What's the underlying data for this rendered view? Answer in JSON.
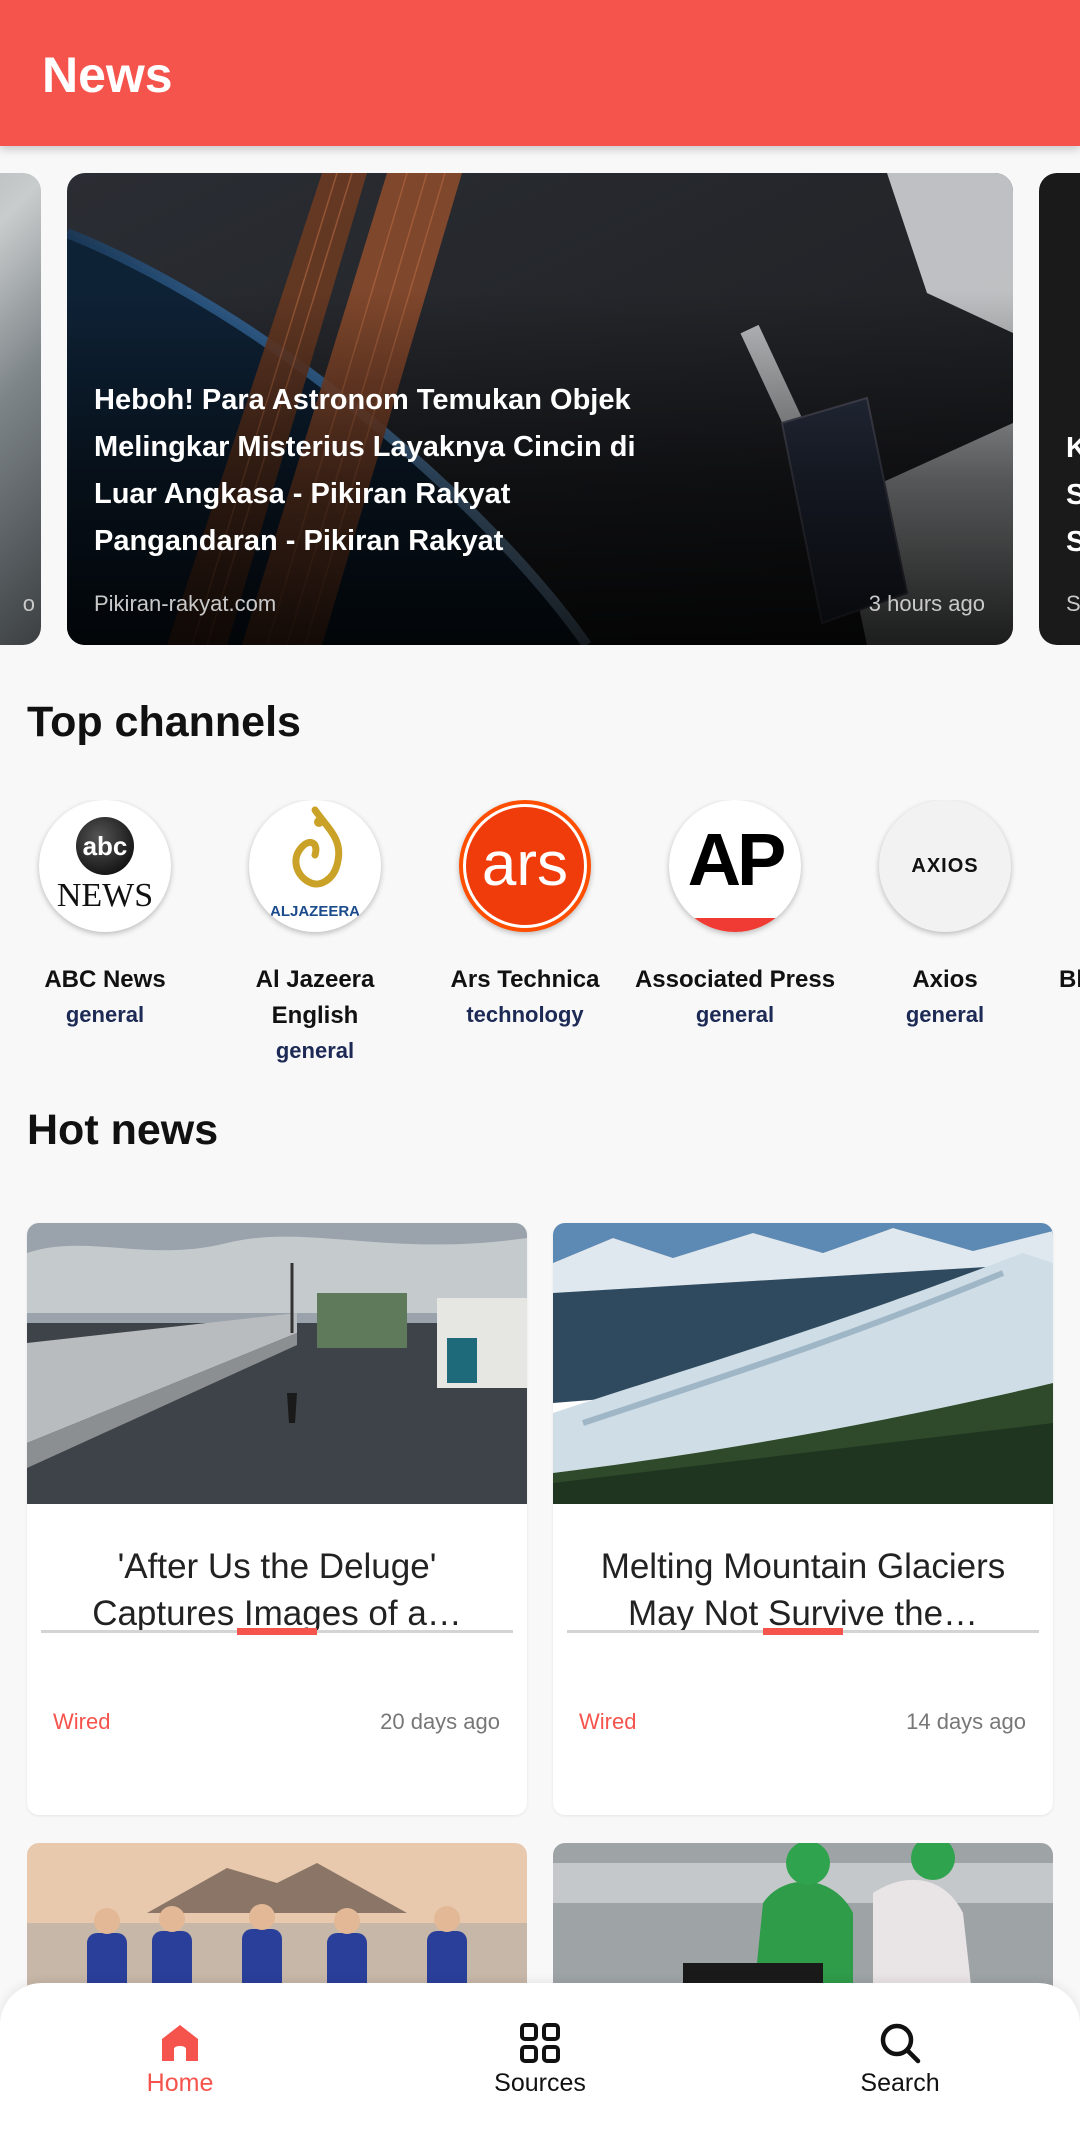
{
  "app": {
    "title": "News"
  },
  "carousel": {
    "prev": {
      "meta": "o"
    },
    "main": {
      "title": "Heboh! Para Astronom Temukan Objek Melingkar Misterius Layaknya Cincin di Luar Angkasa - Pikiran Rakyat Pangandaran - Pikiran Rakyat",
      "source": "Pikiran-rakyat.com",
      "time": "3 hours ago"
    },
    "next": {
      "line1": "K",
      "line2": "S",
      "line3": "S",
      "meta": "S"
    }
  },
  "top_channels": {
    "title": "Top channels",
    "items": [
      {
        "name": "ABC News",
        "category": "general",
        "logo": "abc-news-logo"
      },
      {
        "name": "Al Jazeera English",
        "category": "general",
        "logo": "al-jazeera-logo"
      },
      {
        "name": "Ars Technica",
        "category": "technology",
        "logo": "ars-technica-logo"
      },
      {
        "name": "Associated Press",
        "category": "general",
        "logo": "associated-press-logo"
      },
      {
        "name": "Axios",
        "category": "general",
        "logo": "axios-logo"
      },
      {
        "name": "Bl",
        "category": "",
        "logo": ""
      }
    ]
  },
  "hot_news": {
    "title": "Hot news",
    "items": [
      {
        "title": "'After Us the Deluge' Captures Images of a…",
        "source": "Wired",
        "time": "20 days ago"
      },
      {
        "title": "Melting Mountain Glaciers May Not Survive the…",
        "source": "Wired",
        "time": "14 days ago"
      }
    ]
  },
  "logos": {
    "abc_line1": "abc",
    "abc_line2": "NEWS",
    "aljazeera": "ALJAZEERA",
    "ars": "ars",
    "ap": "AP",
    "axios": "AXIOS"
  },
  "bottom_nav": {
    "items": [
      {
        "label": "Home",
        "icon": "home-icon",
        "active": true
      },
      {
        "label": "Sources",
        "icon": "grid-icon",
        "active": false
      },
      {
        "label": "Search",
        "icon": "search-icon",
        "active": false
      }
    ]
  },
  "colors": {
    "accent": "#f5544d",
    "category": "#1c2a55"
  }
}
